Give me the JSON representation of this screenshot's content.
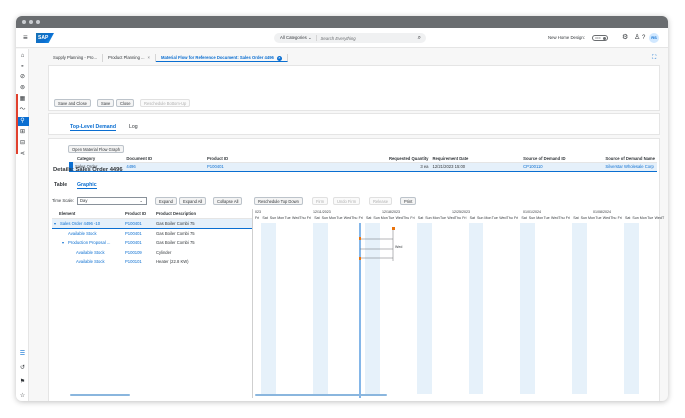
{
  "shell": {
    "search_category": "All Categories",
    "search_placeholder": "Search Everything",
    "new_home_design_label": "New Home Design:",
    "toggle_state": "OFF",
    "avatar": "RS",
    "logo": "SAP"
  },
  "tabs": [
    {
      "label": "Supply Planning - Pro..."
    },
    {
      "label": "Product Planning ...",
      "close": "×"
    },
    {
      "label": "Material Flow for Reference Document: Sales Order 4496",
      "close": "×"
    }
  ],
  "toolbar": {
    "save_close": "Save and Close",
    "save": "Save",
    "close": "Close",
    "reschedule": "Reschedule Bottom-Up"
  },
  "section_tabs": {
    "top_level_demand": "Top-Level Demand",
    "log": "Log"
  },
  "demand": {
    "open_graph": "Open Material Flow Graph",
    "headers": [
      "Category",
      "Document ID",
      "Product ID",
      "Requested Quantity",
      "Requirement Date",
      "Source of Demand ID",
      "Source of Demand Name"
    ],
    "row": {
      "category": "Sales Order",
      "document_id": "4496",
      "product_id": "P100401",
      "quantity": "3",
      "unit": "ea",
      "date": "12/21/2023 15:00",
      "source_id": "CP100110",
      "source_name": "Silverstar Wholesale Corp"
    }
  },
  "details": {
    "title": "Details: Sales Order 4496",
    "tab_table": "Table",
    "tab_graphic": "Graphic",
    "time_scale_label": "Time Scale:",
    "time_scale_value": "Day",
    "expand": "Expand",
    "expand_all": "Expand All",
    "collapse_all": "Collapse All",
    "reschedule_top_down": "Reschedule Top Down",
    "firm": "Firm",
    "undo_firm": "Undo Firm",
    "release": "Release",
    "print": "Print"
  },
  "tree": {
    "headers": [
      "Element",
      "Product ID",
      "Product Description"
    ],
    "rows": [
      {
        "element": "Sales Order 4496 -10",
        "product_id": "P100401",
        "description": "Gas Boiler Combi 75",
        "toggle": "▾",
        "indent": 0
      },
      {
        "element": "Available Stock",
        "product_id": "P100401",
        "description": "Gas Boiler Combi 75",
        "toggle": "",
        "indent": 1
      },
      {
        "element": "Production Proposal ...",
        "product_id": "P100401",
        "description": "Gas Boiler Combi 75",
        "toggle": "▾",
        "indent": 1
      },
      {
        "element": "Available Stock",
        "product_id": "P100109",
        "description": "Cylinder",
        "toggle": "",
        "indent": 2
      },
      {
        "element": "Available Stock",
        "product_id": "P100101",
        "description": "Heater (22.8 KW)",
        "toggle": "",
        "indent": 2
      }
    ]
  },
  "gantt": {
    "weeks": [
      "023",
      "12/11/2023",
      "12/18/2023",
      "12/25/2023",
      "01/01/2024",
      "01/08/2024"
    ],
    "day_labels": [
      "Fri",
      "Sat",
      "Sun",
      "Mon",
      "Tue",
      "Wed",
      "Thu",
      "Fri",
      "Sat",
      "Sun",
      "Mon",
      "Tue",
      "Wed",
      "Thu",
      "Fri",
      "Sat",
      "Sun",
      "Mon",
      "Tue",
      "Wed",
      "Thu",
      "Fri",
      "Sat",
      "Sun",
      "Mon",
      "Tue",
      "Wed",
      "Thu",
      "Fri",
      "Sat",
      "Sun",
      "Mon",
      "Tue",
      "Wed",
      "Thu",
      "Fri",
      "Sat",
      "Sun",
      "Mon",
      "Tue",
      "Wed",
      "Thu",
      "Fri",
      "Sat",
      "Sun",
      "Mon",
      "Tue",
      "Wed",
      "Thu",
      "Fri",
      "Sat",
      "Sun",
      "Mon",
      "Tue",
      "Wed",
      "T"
    ],
    "bar_label": "Wed",
    "colors": {
      "weekend": "#e6f1fa",
      "today": "#0a6ed1",
      "milestone": "#e9730c"
    }
  }
}
